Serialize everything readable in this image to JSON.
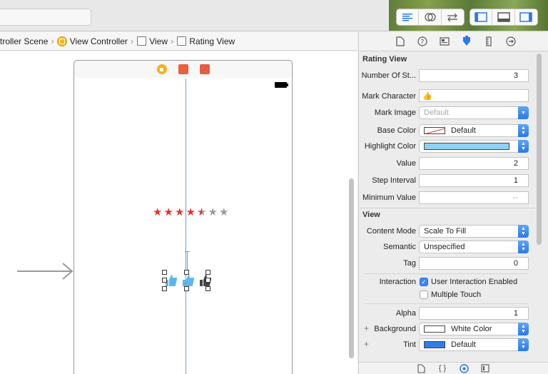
{
  "breadcrumb": {
    "items": [
      "troller Scene",
      "View Controller",
      "View",
      "Rating View"
    ]
  },
  "canvas": {
    "rating_stars": [
      "★",
      "★",
      "★",
      "★",
      "★",
      "★",
      "★"
    ],
    "star_colors": [
      "#e8312a",
      "#e8312a",
      "#e8312a",
      "#e8312a",
      "half",
      "#9a9a9a",
      "#9a9a9a"
    ],
    "thumb_icons": [
      "thumbs-up-blue-icon",
      "thumbs-up-blue-icon",
      "thumbs-up-dark-icon"
    ]
  },
  "inspector": {
    "rating_section_title": "Rating View",
    "number_of_stars_label": "Number Of St...",
    "number_of_stars_value": "3",
    "mark_character_label": "Mark Character",
    "mark_character_value": "👍",
    "mark_image_label": "Mark Image",
    "mark_image_value": "Default",
    "base_color_label": "Base Color",
    "base_color_value": "Default",
    "highlight_color_label": "Highlight Color",
    "highlight_color_hex": "#8fd0f5",
    "value_label": "Value",
    "value_value": "2",
    "step_interval_label": "Step Interval",
    "step_interval_value": "1",
    "minimum_value_label": "Minimum Value",
    "minimum_value_value": "--",
    "view_section_title": "View",
    "content_mode_label": "Content Mode",
    "content_mode_value": "Scale To Fill",
    "semantic_label": "Semantic",
    "semantic_value": "Unspecified",
    "tag_label": "Tag",
    "tag_value": "0",
    "interaction_label": "Interaction",
    "user_interaction_label": "User Interaction Enabled",
    "user_interaction_checked": true,
    "multiple_touch_label": "Multiple Touch",
    "multiple_touch_checked": false,
    "alpha_label": "Alpha",
    "alpha_value": "1",
    "background_label": "Background",
    "background_value": "White Color",
    "tint_label": "Tint",
    "tint_value": "Default",
    "tint_hex": "#2f7fe8"
  },
  "colors": {
    "accent": "#2a7ae6",
    "guide": "#6d9fd2"
  }
}
